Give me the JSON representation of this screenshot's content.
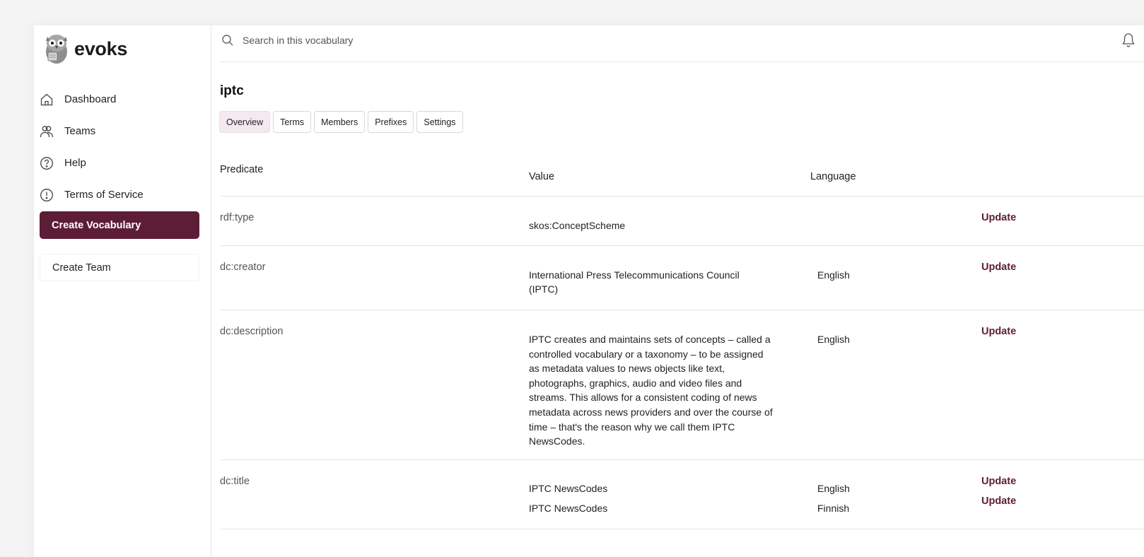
{
  "brand": {
    "name": "evoks"
  },
  "sidebar": {
    "items": [
      {
        "label": "Dashboard",
        "icon": "home-icon"
      },
      {
        "label": "Teams",
        "icon": "users-icon"
      },
      {
        "label": "Help",
        "icon": "help-icon"
      },
      {
        "label": "Terms of Service",
        "icon": "info-icon"
      }
    ],
    "create_vocabulary_label": "Create Vocabulary",
    "create_team_label": "Create Team"
  },
  "search": {
    "placeholder": "Search in this vocabulary",
    "value": ""
  },
  "page": {
    "title": "iptc"
  },
  "tabs": [
    {
      "label": "Overview",
      "active": true
    },
    {
      "label": "Terms",
      "active": false
    },
    {
      "label": "Members",
      "active": false
    },
    {
      "label": "Prefixes",
      "active": false
    },
    {
      "label": "Settings",
      "active": false
    }
  ],
  "table": {
    "headers": {
      "predicate": "Predicate",
      "value": "Value",
      "language": "Language"
    },
    "update_label": "Update",
    "rows": [
      {
        "predicate": "rdf:type",
        "entries": [
          {
            "value": "skos:ConceptScheme",
            "language": ""
          }
        ]
      },
      {
        "predicate": "dc:creator",
        "entries": [
          {
            "value": "International Press Telecommunications Council (IPTC)",
            "language": "English"
          }
        ]
      },
      {
        "predicate": "dc:description",
        "entries": [
          {
            "value": "IPTC creates and maintains sets of concepts – called a controlled vocabulary or a taxonomy – to be assigned as metadata values to news objects like text, photographs, graphics, audio and video files and streams. This allows for a consistent coding of news metadata across news providers and over the course of time – that's the reason why we call them IPTC NewsCodes.",
            "language": "English"
          }
        ]
      },
      {
        "predicate": "dc:title",
        "entries": [
          {
            "value": "IPTC NewsCodes",
            "language": "English"
          },
          {
            "value": "IPTC NewsCodes",
            "language": "Finnish"
          }
        ]
      }
    ]
  },
  "colors": {
    "accent": "#5d1d37",
    "tab_active_bg": "#f3e9ee"
  }
}
